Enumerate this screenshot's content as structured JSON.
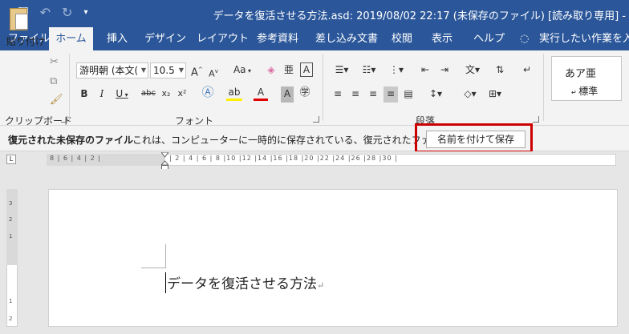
{
  "titlebar": {
    "save_icon": "save-icon",
    "undo_icon": "undo-icon",
    "redo_icon": "redo-icon",
    "customize_icon": "customize-qat-icon",
    "title": "データを復活させる方法.asd: 2019/08/02 22:17 (未保存のファイル) [読み取り専用] -"
  },
  "tabs": [
    "ファイル",
    "ホーム",
    "挿入",
    "デザイン",
    "レイアウト",
    "参考資料",
    "差し込み文書",
    "校閲",
    "表示",
    "ヘルプ"
  ],
  "active_tab": "ホーム",
  "tell_me": "実行したい作業を入",
  "ribbon": {
    "clipboard": {
      "paste_label": "貼り付け",
      "group_label": "クリップボード"
    },
    "font": {
      "font_name": "游明朝 (本文(",
      "font_size": "10.5",
      "grow": "A",
      "shrink": "A",
      "change_case": "Aa",
      "bold": "B",
      "italic": "I",
      "underline": "U",
      "strike": "abc",
      "subscript": "x₂",
      "superscript": "x²",
      "group_label": "フォント"
    },
    "paragraph": {
      "group_label": "段落"
    },
    "styles": {
      "sample": "あア亜",
      "name": "標準"
    }
  },
  "infobar": {
    "title": "復元された未保存のファイル",
    "message": "これは、コンピューターに一時的に保存されている、復元されたファイルです。",
    "button_label": "名前を付けて保存"
  },
  "ruler": {
    "left_numbers": "8 | 6 | 4 | 2 |",
    "right_numbers": "| 2 | 4 | 6 | 8 |10 |12 |14 |16 |18 |20 |22 |24 |26 |28 |30 |",
    "vertical_numbers": [
      "3",
      "2",
      "1",
      "1",
      "2"
    ]
  },
  "document": {
    "text": "データを復活させる方法",
    "pilcrow": "↵"
  },
  "colors": {
    "word_blue": "#2b579a",
    "ribbon_bg": "#f3f3f3",
    "highlight_frame": "#cc0000"
  }
}
